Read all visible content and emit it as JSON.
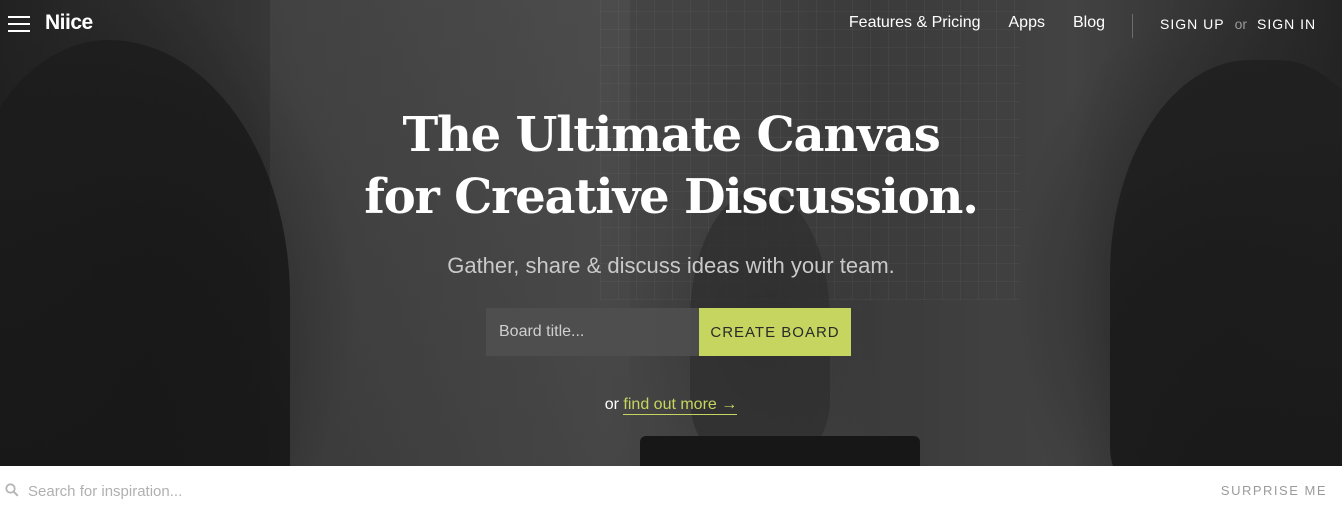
{
  "header": {
    "logo": "Niice",
    "nav": [
      {
        "label": "Features & Pricing"
      },
      {
        "label": "Apps"
      },
      {
        "label": "Blog"
      }
    ],
    "sign_up": "SIGN UP",
    "or": "or",
    "sign_in": "SIGN IN"
  },
  "hero": {
    "headline_line1": "The Ultimate Canvas",
    "headline_line2": "for Creative Discussion.",
    "subheadline": "Gather, share & discuss ideas with your team.",
    "board_input_placeholder": "Board title...",
    "create_button": "CREATE BOARD",
    "or_prefix": "or",
    "find_out_more": "find out more →"
  },
  "search": {
    "placeholder": "Search for inspiration...",
    "surprise": "SURPRISE ME"
  },
  "colors": {
    "accent": "#c6d55f",
    "white": "#ffffff"
  },
  "icons": {
    "menu": "menu-icon",
    "search": "search-icon"
  }
}
